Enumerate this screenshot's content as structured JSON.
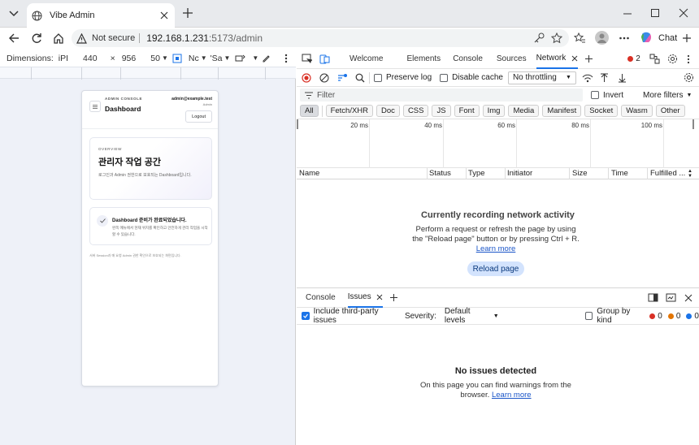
{
  "browser": {
    "tab_title": "Vibe Admin",
    "security_label": "Not secure",
    "url_host": "192.168.1.231",
    "url_rest": ":5173/admin",
    "chat_label": "Chat"
  },
  "device_toolbar": {
    "dimensions_label": "Dimensions:",
    "device": "iPI",
    "width": "440",
    "times": "×",
    "height": "956",
    "zoom": "50",
    "throttle": "Nc",
    "save": "'Sa"
  },
  "app": {
    "brand_small": "ADMIN CONSOLE",
    "page_title": "Dashboard",
    "user_email": "admin@example.test",
    "user_role": "Admin",
    "logout_label": "Logout",
    "overview_eyebrow": "OVERVIEW",
    "hero_title": "관리자 작업 공간",
    "hero_desc": "로그인과 Admin 권한으로 보호되는 Dashboard입니다.",
    "ready_title": "Dashboard 준비가 완료되었습니다.",
    "ready_desc": "왼쪽 메뉴에서 현재 위치를 확인하고 안전하게 관리 작업을 시작할 수 있습니다.",
    "footer_note": "서버 Session과 매 요청 Admin 권한 확인으로 보호되는 화면입니다."
  },
  "devtools": {
    "tabs": [
      "Welcome",
      "Elements",
      "Console",
      "Sources",
      "Network"
    ],
    "active_tab": "Network",
    "error_count": "2",
    "preserve_log": "Preserve log",
    "disable_cache": "Disable cache",
    "throttling": "No throttling",
    "filter_placeholder": "Filter",
    "invert": "Invert",
    "more_filters": "More filters",
    "type_filters": [
      "All",
      "Fetch/XHR",
      "Doc",
      "CSS",
      "JS",
      "Font",
      "Img",
      "Media",
      "Manifest",
      "Socket",
      "Wasm",
      "Other"
    ],
    "timeline_ticks": [
      "20 ms",
      "40 ms",
      "60 ms",
      "80 ms",
      "100 ms"
    ],
    "columns": [
      "Name",
      "Status",
      "Type",
      "Initiator",
      "Size",
      "Time",
      "Fulfilled ..."
    ],
    "recording_title": "Currently recording network activity",
    "recording_desc": "Perform a request or refresh the page by using the \"Reload page\" button or by pressing Ctrl + R.",
    "learn_more": "Learn more",
    "reload_button": "Reload page",
    "drawer_tabs": [
      "Console",
      "Issues"
    ],
    "include_third_party": "Include third-party issues",
    "severity_label": "Severity:",
    "severity_value": "Default levels",
    "group_by_kind": "Group by kind",
    "issue_counts": [
      "0",
      "0",
      "0"
    ],
    "no_issues_title": "No issues detected",
    "no_issues_desc": "On this page you can find warnings from the browser.",
    "no_issues_learn_more": "Learn more"
  },
  "colors": {
    "accent": "#1a73e8",
    "error": "#d93025",
    "warning": "#e37400",
    "info": "#1a73e8",
    "reload_button_bg": "#d3e3fd",
    "phone_bg": "#eef1f8"
  }
}
